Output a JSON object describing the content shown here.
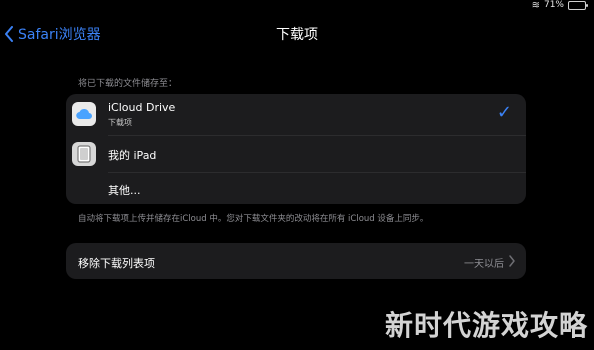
{
  "status_bar": {
    "battery_text": "71%"
  },
  "nav": {
    "back_label": "Safari浏览器",
    "title": "下载项"
  },
  "downloads": {
    "section_label": "将已下载的文件储存至：",
    "options": [
      {
        "title": "iCloud Drive",
        "subtitle": "下载项",
        "icon": "icloud-icon",
        "selected": true
      },
      {
        "title": "我的 iPad",
        "subtitle": "",
        "icon": "ipad-icon",
        "selected": false
      },
      {
        "title": "其他...",
        "subtitle": "",
        "icon": "",
        "selected": false
      }
    ],
    "note": "自动将下载项上传并储存在iCloud 中。您对下载文件夹的改动将在所有 iCloud 设备上同步。"
  },
  "remove_list": {
    "label": "移除下载列表项",
    "value": "一天以后"
  },
  "watermark": {
    "text": "新时代游戏攻略"
  },
  "colors": {
    "background": "#000000",
    "group_bg": "#1c1c1e",
    "accent": "#3b82f6",
    "secondary_text": "#8e8e93"
  }
}
